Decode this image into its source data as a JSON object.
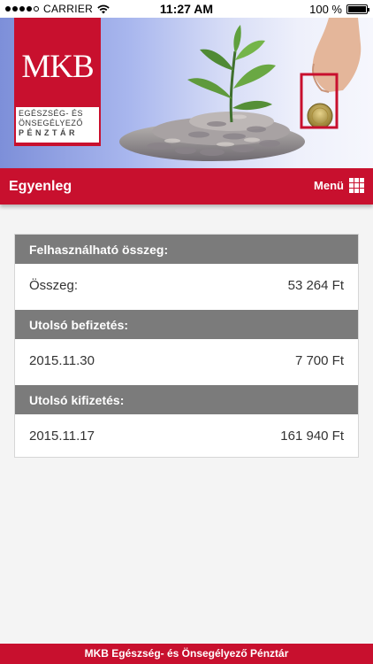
{
  "status_bar": {
    "carrier": "CARRIER",
    "time": "11:27 AM",
    "battery": "100 %",
    "battery_level": 1.0,
    "signal_icon": "signal-dots-icon",
    "wifi_icon": "wifi-icon"
  },
  "logo": {
    "main": "MKB",
    "line1": "EGÉSZSÉG- ÉS",
    "line2": "ÖNSEGÉLYEZŐ",
    "line3": "PÉNZTÁR"
  },
  "header": {
    "title": "Egyenleg",
    "menu_label": "Menü",
    "menu_icon": "grid-menu-icon"
  },
  "sections": [
    {
      "heading": "Felhasználható összeg:",
      "label": "Összeg:",
      "value": "53 264 Ft"
    },
    {
      "heading": "Utolsó befizetés:",
      "label": "2015.11.30",
      "value": "7 700 Ft"
    },
    {
      "heading": "Utolsó kifizetés:",
      "label": "2015.11.17",
      "value": "161 940 Ft"
    }
  ],
  "footer": {
    "text": "MKB Egészség- és Önsegélyező Pénztár"
  },
  "colors": {
    "brand_red": "#c8102e",
    "section_gray": "#7b7b7b",
    "background": "#f4f4f4"
  }
}
